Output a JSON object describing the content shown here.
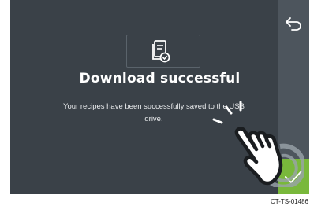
{
  "dialog": {
    "title": "Download successful",
    "message_line1": "Your recipes have been successfully saved to the USB",
    "message_line2": "drive.",
    "icon": "document-check-icon"
  },
  "controls": {
    "back_icon": "back-arrow-icon",
    "confirm_icon": "checkmark-icon"
  },
  "overlay": {
    "gesture_icon": "tap-hand-icon"
  },
  "figure_code": "CT-TS-01486",
  "colors": {
    "screen_bg": "#3a4148",
    "side_strip": "#4d555d",
    "confirm": "#79b83b"
  }
}
